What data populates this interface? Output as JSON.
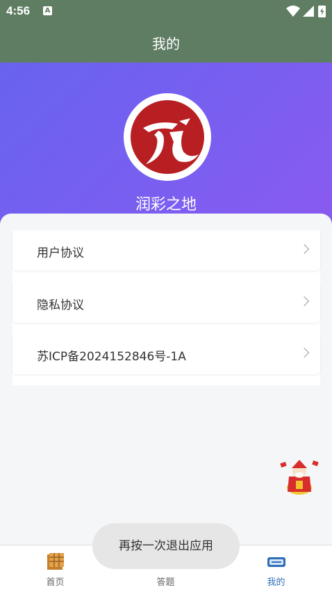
{
  "status_bar": {
    "time": "4:56",
    "notification_icon": "A"
  },
  "app_bar": {
    "title": "我的"
  },
  "profile": {
    "name": "润彩之地"
  },
  "menu": [
    {
      "label": "用户协议"
    },
    {
      "label": "隐私协议"
    },
    {
      "label": "苏ICP备2024152846号-1A"
    }
  ],
  "tabs": [
    {
      "label": "首页",
      "icon": "home-icon",
      "active": false
    },
    {
      "label": "答题",
      "icon": "quiz-icon",
      "active": false
    },
    {
      "label": "我的",
      "icon": "profile-icon",
      "active": true
    }
  ],
  "toast": {
    "text": "再按一次退出应用"
  },
  "colors": {
    "header": "#5f7d63",
    "gradient_start": "#6863ef",
    "gradient_end": "#8a5af0",
    "active_tab": "#2f6fb8",
    "logo_red": "#b81f23"
  }
}
